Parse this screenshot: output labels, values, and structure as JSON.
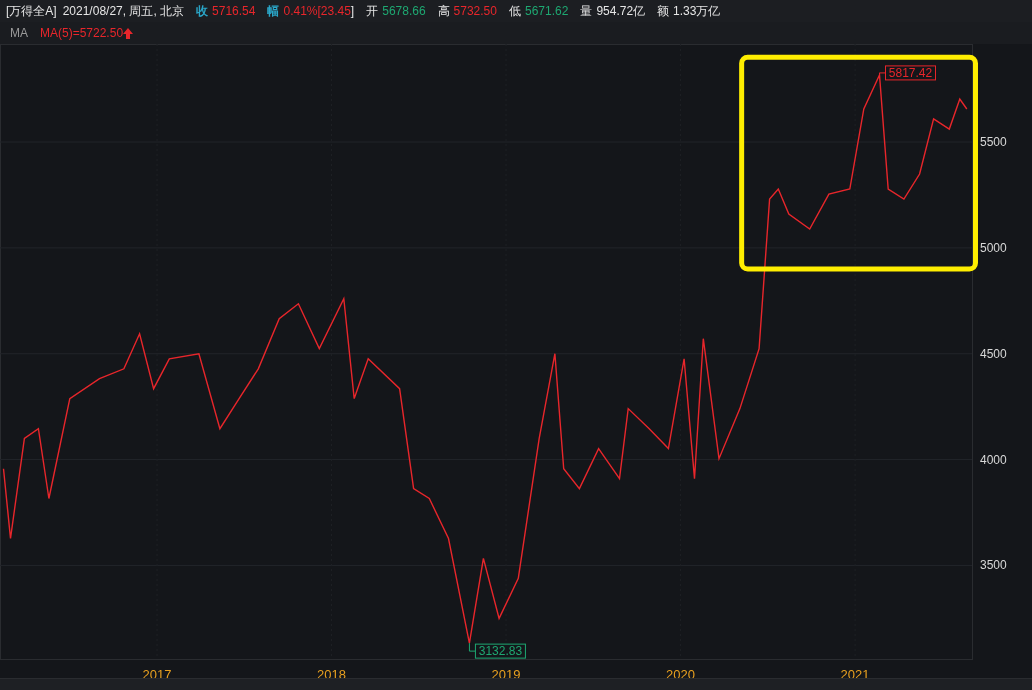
{
  "quote_bar": {
    "symbol": "[万得全A]",
    "date": "2021/08/27, 周五, 北京",
    "fields": [
      {
        "kind": "label",
        "text": "收",
        "color": "#2aa6c8"
      },
      {
        "kind": "value",
        "text": "5716.54",
        "color": "#e8262b"
      },
      {
        "kind": "label",
        "text": "幅",
        "color": "#2aa6c8"
      },
      {
        "kind": "value",
        "text": "0.41%[23.45",
        "color": "#e8262b"
      },
      {
        "kind": "suffix",
        "text": "]"
      },
      {
        "kind": "label",
        "text": "开"
      },
      {
        "kind": "value",
        "text": "5678.66",
        "color": "#1ea872"
      },
      {
        "kind": "label",
        "text": "高"
      },
      {
        "kind": "value",
        "text": "5732.50",
        "color": "#e8262b"
      },
      {
        "kind": "label",
        "text": "低"
      },
      {
        "kind": "value",
        "text": "5671.62",
        "color": "#1ea872"
      },
      {
        "kind": "label",
        "text": "量"
      },
      {
        "kind": "value",
        "text": "954.72亿"
      },
      {
        "kind": "label",
        "text": "额"
      },
      {
        "kind": "value",
        "text": "1.33万亿"
      }
    ]
  },
  "indicator_bar": {
    "name": "MA",
    "value": "MA(5)=5722.50",
    "rising": true
  },
  "chart": {
    "chart_data": {
      "type": "line",
      "grid": true,
      "xlim": [
        2016.1,
        2021.67
      ],
      "ylim": [
        3058,
        5963
      ],
      "xticks": [
        {
          "value": 2017,
          "label": "2017"
        },
        {
          "value": 2018,
          "label": "2018"
        },
        {
          "value": 2019,
          "label": "2019"
        },
        {
          "value": 2020,
          "label": "2020"
        },
        {
          "value": 2021,
          "label": "2021"
        }
      ],
      "yticks": [
        3500,
        4000,
        4500,
        5000,
        5500
      ],
      "x": [
        2016.12,
        2016.16,
        2016.24,
        2016.32,
        2016.38,
        2016.5,
        2016.67,
        2016.81,
        2016.9,
        2016.98,
        2017.07,
        2017.24,
        2017.36,
        2017.47,
        2017.58,
        2017.7,
        2017.81,
        2017.93,
        2018.07,
        2018.13,
        2018.21,
        2018.39,
        2018.47,
        2018.56,
        2018.67,
        2018.79,
        2018.87,
        2018.96,
        2019.07,
        2019.19,
        2019.28,
        2019.33,
        2019.42,
        2019.53,
        2019.65,
        2019.7,
        2019.82,
        2019.93,
        2020.02,
        2020.08,
        2020.13,
        2020.22,
        2020.34,
        2020.45,
        2020.51,
        2020.56,
        2020.62,
        2020.74,
        2020.85,
        2020.97,
        2021.05,
        2021.14,
        2021.19,
        2021.28,
        2021.37,
        2021.45,
        2021.54,
        2021.6,
        2021.64
      ],
      "series": [
        {
          "color": "#e8262b",
          "values": [
            3957,
            3627,
            4100,
            4146,
            3816,
            4288,
            4382,
            4429,
            4594,
            4335,
            4476,
            4500,
            4146,
            4288,
            4429,
            4665,
            4736,
            4524,
            4760,
            4288,
            4476,
            4335,
            3863,
            3816,
            3627,
            3133,
            3533,
            3250,
            3439,
            4100,
            4500,
            3957,
            3863,
            4052,
            3910,
            4241,
            4146,
            4052,
            4476,
            3910,
            4571,
            4004,
            4241,
            4524,
            5231,
            5278,
            5160,
            5089,
            5254,
            5278,
            5656,
            5817,
            5278,
            5231,
            5349,
            5609,
            5561,
            5703,
            5656
          ]
        }
      ]
    },
    "extreme_labels": [
      {
        "kind": "max",
        "text": "5817.42",
        "color": "#e8262b"
      },
      {
        "kind": "min",
        "text": "3132.83",
        "color": "#1ea872"
      }
    ]
  }
}
